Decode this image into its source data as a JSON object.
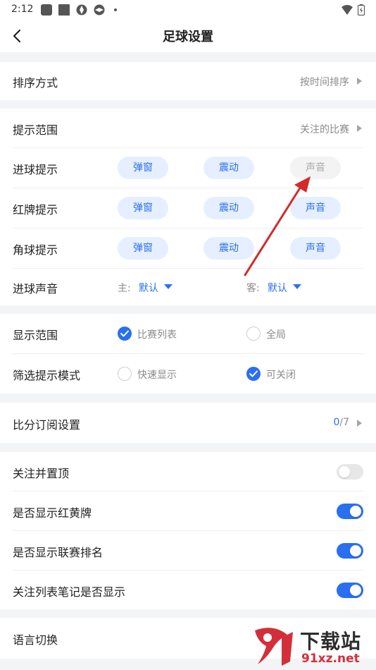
{
  "status_bar": {
    "time": "2:12"
  },
  "header": {
    "title": "足球设置"
  },
  "sort": {
    "label": "排序方式",
    "value": "按时间排序"
  },
  "tip_scope": {
    "label": "提示范围",
    "value": "关注的比赛"
  },
  "goal_tip": {
    "label": "进球提示",
    "popup": "弹窗",
    "vibrate": "震动",
    "sound": "声音",
    "popup_on": true,
    "vibrate_on": true,
    "sound_on": false
  },
  "red_card_tip": {
    "label": "红牌提示",
    "popup": "弹窗",
    "vibrate": "震动",
    "sound": "声音",
    "popup_on": true,
    "vibrate_on": true,
    "sound_on": true
  },
  "corner_tip": {
    "label": "角球提示",
    "popup": "弹窗",
    "vibrate": "震动",
    "sound": "声音",
    "popup_on": true,
    "vibrate_on": true,
    "sound_on": true
  },
  "goal_sound": {
    "label": "进球声音",
    "home_prefix": "主:",
    "home_value": "默认",
    "away_prefix": "客:",
    "away_value": "默认"
  },
  "display_scope": {
    "label": "显示范围",
    "option1": "比赛列表",
    "option2": "全局",
    "selected": "比赛列表"
  },
  "filter_mode": {
    "label": "筛选提示模式",
    "option1": "快速显示",
    "option2": "可关闭",
    "selected": "可关闭"
  },
  "score_sub": {
    "label": "比分订阅设置",
    "count": "0",
    "total": "/7"
  },
  "follow_top": {
    "label": "关注并置顶",
    "on": false
  },
  "show_cards": {
    "label": "是否显示红黄牌",
    "on": true
  },
  "show_rank": {
    "label": "是否显示联赛排名",
    "on": true
  },
  "show_notes": {
    "label": "关注列表笔记是否显示",
    "on": true
  },
  "language": {
    "label": "语言切换"
  },
  "watermark": {
    "title": "下载站",
    "domain": "91xz.net"
  },
  "colors": {
    "accent": "#2a6ff0",
    "pill_bg": "#e6efff",
    "annotation": "#d42a2a"
  }
}
